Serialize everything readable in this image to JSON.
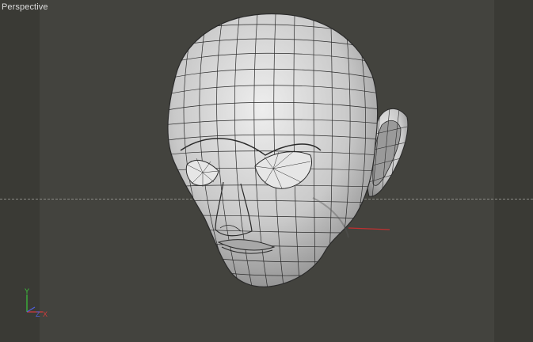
{
  "viewport": {
    "label": "Perspective",
    "background": "#43433e",
    "side_strip_color": "#3a3a35",
    "grid_line_style": "dashed"
  },
  "gizmo": {
    "x_label": "X",
    "y_label": "Y",
    "z_label": "Z",
    "x_color": "#d23c3c",
    "y_color": "#3cc83c",
    "z_color": "#5060e0"
  },
  "model": {
    "mesh_color": "#d6d6d6",
    "wire_color": "#2a2a2a",
    "pivot_marker_color": "#c03030"
  }
}
